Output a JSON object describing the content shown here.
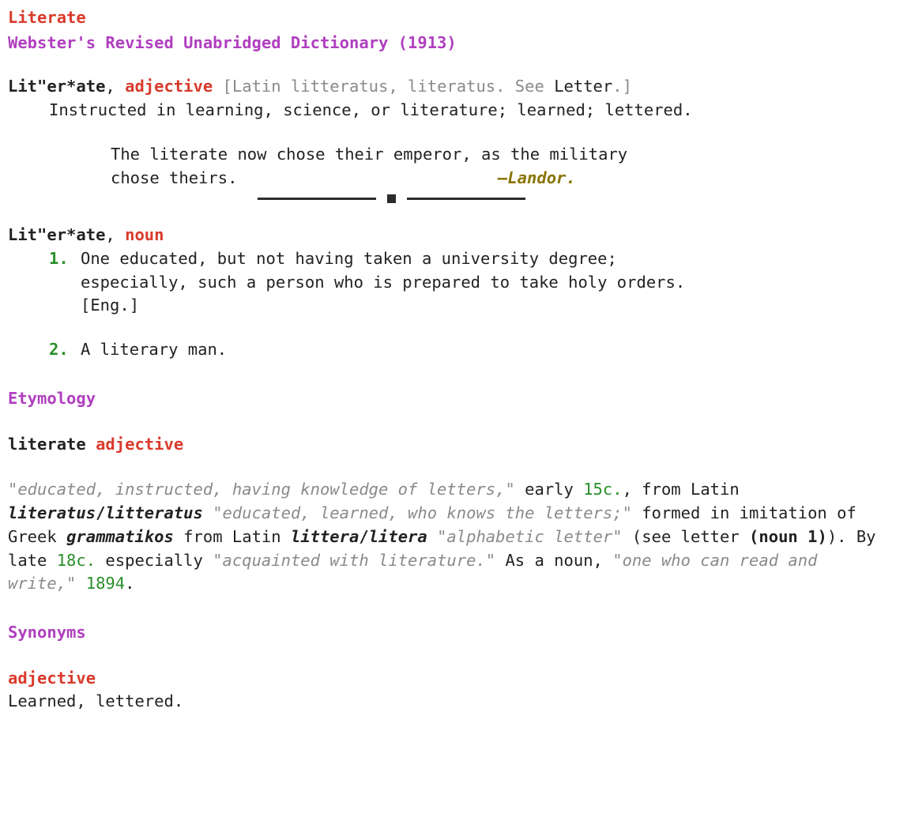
{
  "header": {
    "word": "Literate",
    "source": "Webster's Revised Unabridged Dictionary (1913)"
  },
  "entries": [
    {
      "hw": "Lit\"er*ate",
      "comma": ", ",
      "pos": "adjective",
      "sp": " ",
      "ety_open": "[",
      "ety_text": "Latin litteratus, literatus. See ",
      "ety_link": "Letter",
      "ety_close": ".]",
      "def": "Instructed in learning, science, or literature; learned; lettered.",
      "quote": {
        "text": "The literate now chose their emperor, as the military chose theirs.",
        "attr_dash": "—",
        "attr_name": "Landor."
      }
    },
    {
      "hw": "Lit\"er*ate",
      "comma": ", ",
      "pos": "noun",
      "senses": [
        {
          "n": "1.",
          "text": "One educated, but not having taken a university degree; especially, such a person who is prepared to take holy orders. [Eng.]"
        },
        {
          "n": "2.",
          "text": "A literary man."
        }
      ]
    }
  ],
  "etymology": {
    "heading": "Etymology",
    "hw": "literate",
    "sp": " ",
    "pos": "adjective",
    "p": {
      "t1": "\"educated, instructed, having knowledge of letters,\"",
      "t2": " early ",
      "t3": "15c.",
      "t4": ", from Latin ",
      "t5": "literatus",
      "t5b": "/",
      "t5c": "litteratus",
      "t6": " ",
      "t7": "\"educated, learned, who knows the letters;\"",
      "t8": " formed in imitation of Greek ",
      "t9": "grammatikos",
      "t10": " from Latin ",
      "t11": "littera",
      "t11b": "/",
      "t11c": "litera",
      "t12": " ",
      "t13": "\"alphabetic letter\"",
      "t14": " (see ",
      "t15": "letter",
      "t16": " (noun 1)",
      "t17": "). By late ",
      "t18": "18c.",
      "t19": " especially ",
      "t20": "\"acquainted with literature.\"",
      "t21": " As a noun, ",
      "t22": "\"one who can read and write,\"",
      "t23": " ",
      "t24": "1894",
      "t25": "."
    }
  },
  "synonyms": {
    "heading": "Synonyms",
    "pos": "adjective",
    "list": "Learned, lettered."
  }
}
